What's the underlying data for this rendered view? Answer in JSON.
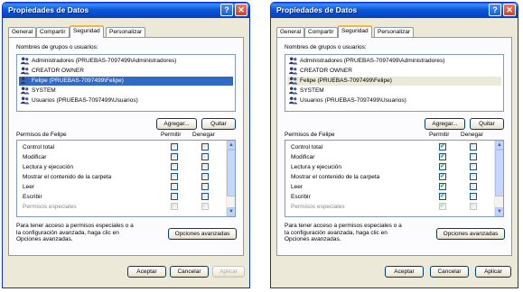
{
  "colors": {
    "title_bar": "#0a58d8",
    "selected_blue": "#316ac5",
    "check_green": "#21a121",
    "tab_highlight": "#f6b53f"
  },
  "dialogs": [
    {
      "title": "Propiedades de Datos",
      "tabs": [
        "General",
        "Compartir",
        "Seguridad",
        "Personalizar"
      ],
      "active_tab": "Seguridad",
      "groups_label": "Nombres de grupos o usuarios:",
      "users": [
        "Administradores (PRUEBAS-7097499\\Administradores)",
        "CREATOR OWNER",
        "Felipe (PRUEBAS-7097499\\Felipe)",
        "SYSTEM",
        "Usuarios (PRUEBAS-7097499\\Usuarios)"
      ],
      "selected_user_index": 2,
      "add_button": "Agregar...",
      "remove_button": "Quitar",
      "permissions_label": "Permisos de Felipe",
      "allow_header": "Permitir",
      "deny_header": "Denegar",
      "permissions": [
        {
          "name": "Control total",
          "allow": false,
          "deny": false
        },
        {
          "name": "Modificar",
          "allow": false,
          "deny": false
        },
        {
          "name": "Lectura y ejecución",
          "allow": false,
          "deny": false
        },
        {
          "name": "Mostrar el contenido de la carpeta",
          "allow": false,
          "deny": false
        },
        {
          "name": "Leer",
          "allow": false,
          "deny": false
        },
        {
          "name": "Escribir",
          "allow": false,
          "deny": false
        },
        {
          "name": "Permisos especiales",
          "allow": false,
          "deny": false
        }
      ],
      "advanced_text": "Para tener acceso a permisos especiales o a la configuración avanzada, haga clic en Opciones avanzadas.",
      "advanced_button": "Opciones avanzadas",
      "ok_button": "Aceptar",
      "cancel_button": "Cancelar",
      "apply_button": "Aplicar"
    },
    {
      "title": "Propiedades de Datos",
      "tabs": [
        "General",
        "Compartir",
        "Seguridad",
        "Personalizar"
      ],
      "active_tab": "Seguridad",
      "groups_label": "Nombres de grupos o usuarios:",
      "users": [
        "Administradores (PRUEBAS-7097499\\Administradores)",
        "CREATOR OWNER",
        "Felipe (PRUEBAS-7097499\\Felipe)",
        "SYSTEM",
        "Usuarios (PRUEBAS-7097499\\Usuarios)"
      ],
      "selected_user_index": 2,
      "add_button": "Agregar...",
      "remove_button": "Quitar",
      "permissions_label": "Permisos de Felipe",
      "allow_header": "Permitir",
      "deny_header": "Denegar",
      "permissions": [
        {
          "name": "Control total",
          "allow": true,
          "deny": false
        },
        {
          "name": "Modificar",
          "allow": true,
          "deny": false
        },
        {
          "name": "Lectura y ejecución",
          "allow": true,
          "deny": false
        },
        {
          "name": "Mostrar el contenido de la carpeta",
          "allow": true,
          "deny": false
        },
        {
          "name": "Leer",
          "allow": true,
          "deny": false
        },
        {
          "name": "Escribir",
          "allow": true,
          "deny": false
        },
        {
          "name": "Permisos especiales",
          "allow": true,
          "deny": false
        }
      ],
      "advanced_text": "Para tener acceso a permisos especiales o a la configuración avanzada, haga clic en Opciones avanzadas.",
      "advanced_button": "Opciones avanzadas",
      "ok_button": "Aceptar",
      "cancel_button": "Cancelar",
      "apply_button": "Aplicar"
    }
  ]
}
